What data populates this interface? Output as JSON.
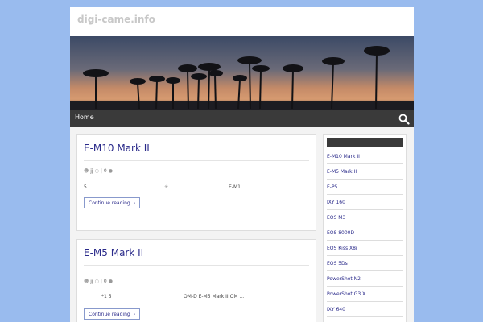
{
  "site": {
    "title": "digi-came.info"
  },
  "nav": {
    "home": "Home"
  },
  "posts": [
    {
      "title": "E-M10 Mark II",
      "meta": {
        "author": "jj",
        "comments": "0"
      },
      "excerpt": [
        "5",
        "E-M1 ..."
      ],
      "continue_label": "Continue reading"
    },
    {
      "title": "E-M5 Mark II",
      "meta": {
        "author": "jj",
        "comments": "0"
      },
      "excerpt": [
        "*1  5",
        "OM-D E-M5 Mark II OM ..."
      ],
      "continue_label": "Continue reading"
    }
  ],
  "sidebar": {
    "items": [
      "E-M10 Mark II",
      "E-M5 Mark II",
      "E-P5",
      "IXY 160",
      "EOS M3",
      "EOS 8000D",
      "EOS Kiss X8i",
      "EOS 5Ds",
      "PowerShot N2",
      "PowerShot G3 X",
      "IXY 640"
    ]
  }
}
